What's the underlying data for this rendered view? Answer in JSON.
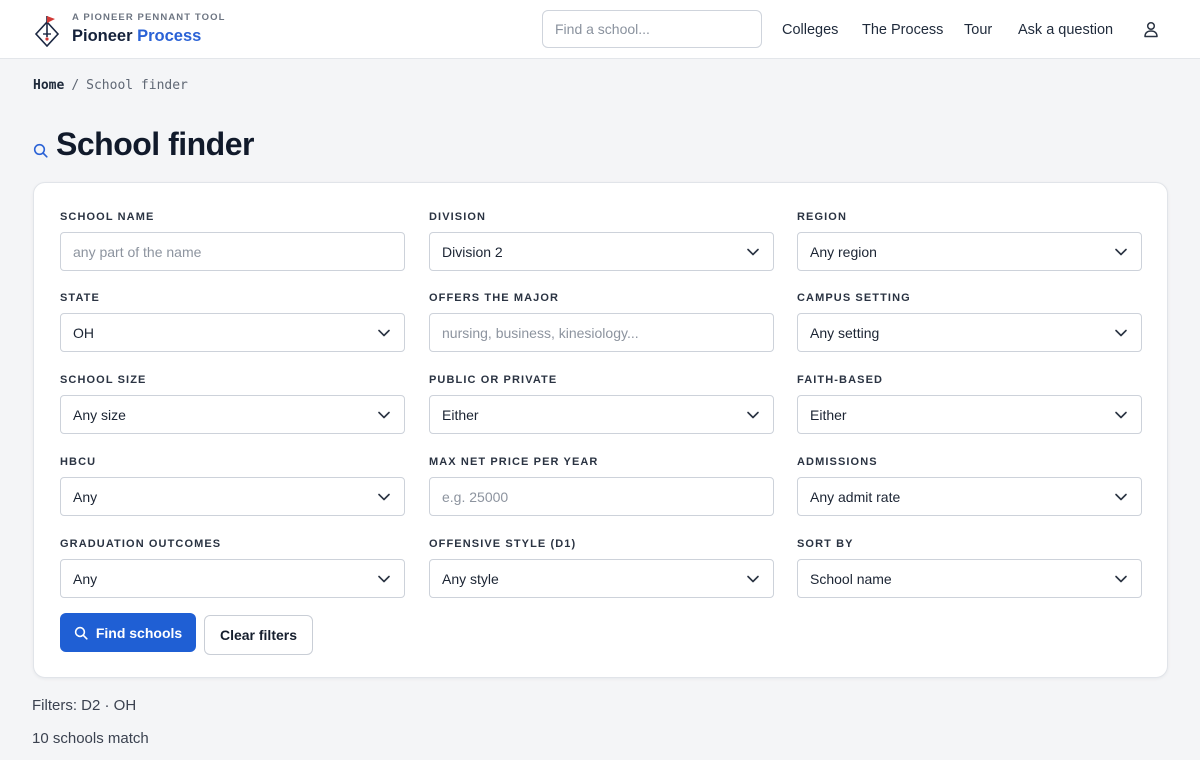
{
  "header": {
    "tagline": "A PIONEER PENNANT TOOL",
    "brand_name_prefix": "Pioneer",
    "brand_name_suffix": "Process",
    "search_placeholder": "Find a school...",
    "nav": [
      {
        "label": "Colleges"
      },
      {
        "label": "The Process"
      },
      {
        "label": "Tour"
      },
      {
        "label": "Ask a question"
      }
    ],
    "accent_color": "#2a62d6"
  },
  "breadcrumb": {
    "home": "Home",
    "separator": "/",
    "current": "School finder"
  },
  "page": {
    "title": "School finder",
    "title_icon": "search-icon"
  },
  "filters": {
    "school_name": {
      "label": "SCHOOL NAME",
      "placeholder": "any part of the name",
      "value": ""
    },
    "division": {
      "label": "DIVISION",
      "value": "Division 2"
    },
    "region": {
      "label": "REGION",
      "value": "Any region"
    },
    "state": {
      "label": "STATE",
      "value": "OH"
    },
    "major": {
      "label": "OFFERS THE MAJOR",
      "placeholder": "nursing, business, kinesiology...",
      "value": ""
    },
    "campus_setting": {
      "label": "CAMPUS SETTING",
      "value": "Any setting"
    },
    "school_size": {
      "label": "SCHOOL SIZE",
      "value": "Any size"
    },
    "public_private": {
      "label": "PUBLIC OR PRIVATE",
      "value": "Either"
    },
    "faith_based": {
      "label": "FAITH-BASED",
      "value": "Either"
    },
    "hbcu": {
      "label": "HBCU",
      "value": "Any"
    },
    "max_net_price": {
      "label": "MAX NET PRICE PER YEAR",
      "placeholder": "e.g. 25000",
      "value": ""
    },
    "admissions": {
      "label": "ADMISSIONS",
      "value": "Any admit rate"
    },
    "graduation_outcomes": {
      "label": "GRADUATION OUTCOMES",
      "value": "Any"
    },
    "offensive_style": {
      "label": "OFFENSIVE STYLE (D1)",
      "value": "Any style"
    },
    "sort_by": {
      "label": "SORT BY",
      "value": "School name"
    }
  },
  "actions": {
    "find_label": "Find schools",
    "clear_label": "Clear filters",
    "primary_color": "#1f5fd4"
  },
  "results": {
    "filters_summary": "Filters: D2 · OH",
    "count_text": "10 schools match"
  }
}
